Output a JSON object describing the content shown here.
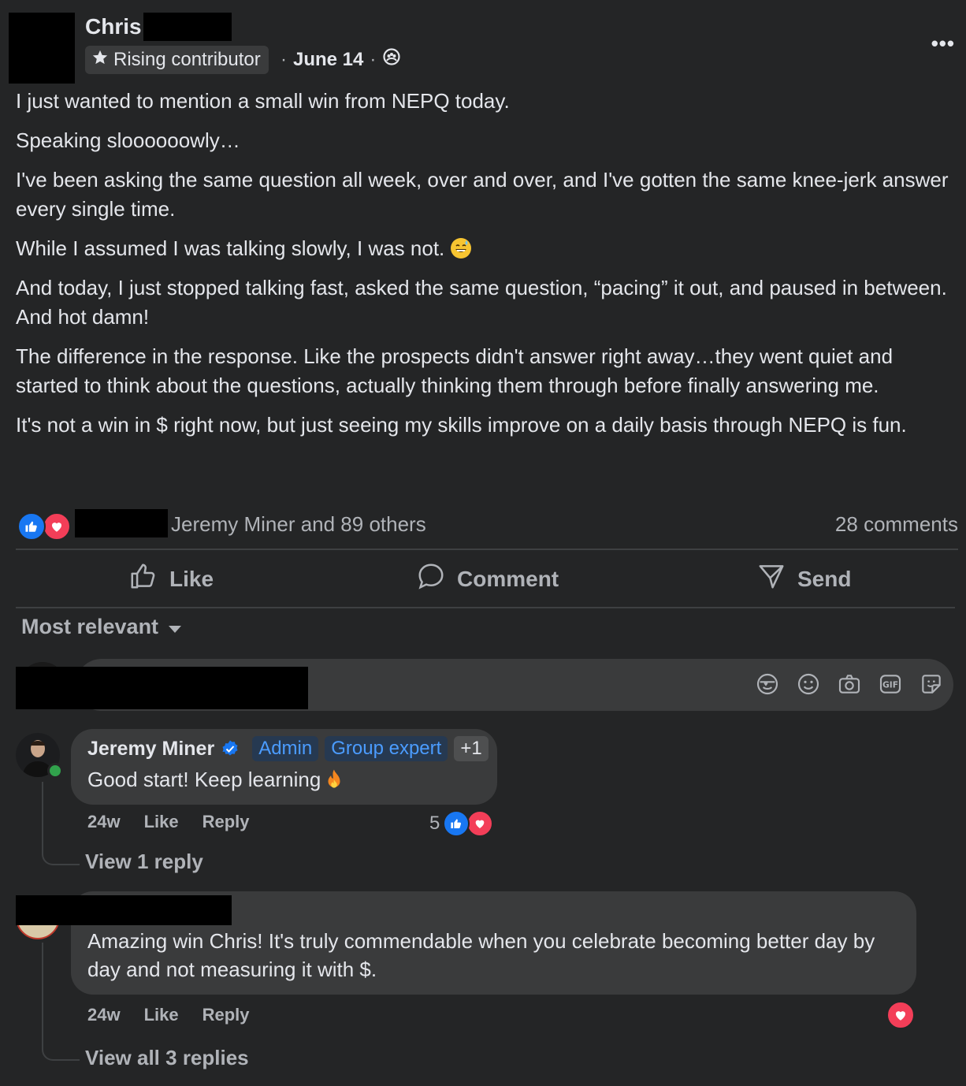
{
  "post": {
    "author_name": "Chris",
    "badge_label": "Rising contributor",
    "meta_separator": "·",
    "date": "June 14",
    "more_label": "•••",
    "paragraphs": [
      "I just wanted to mention a small win from NEPQ today.",
      "Speaking sloooooowly…",
      "I've been asking the same question all week, over and over, and I've gotten the same knee-jerk answer every single time.",
      "While I assumed I was talking slowly, I was not.",
      "And today, I just stopped talking fast, asked the same question, “pacing” it out, and paused in between. And hot damn!",
      "The difference in the response. Like the prospects didn't answer right away…they went quiet and started to think about the questions, actually thinking them through before finally answering me.",
      "It's not a win in $ right now, but just seeing my skills improve on a daily basis through NEPQ is fun."
    ],
    "reactors_text": "Jeremy Miner and 89 others",
    "comments_count": "28 comments"
  },
  "actions": {
    "like": "Like",
    "comment": "Comment",
    "send": "Send"
  },
  "sort": {
    "label": "Most relevant"
  },
  "comments": [
    {
      "name": "Jeremy Miner",
      "tags": [
        "Admin",
        "Group expert",
        "+1"
      ],
      "text": "Good start! Keep learning",
      "time": "24w",
      "like": "Like",
      "reply": "Reply",
      "reaction_count": "5",
      "view_replies": "View 1 reply"
    },
    {
      "name": "",
      "text": "Amazing win Chris! It's truly commendable when you celebrate becoming better day by day and not measuring it with $.",
      "time": "24w",
      "like": "Like",
      "reply": "Reply",
      "view_replies": "View all 3 replies"
    }
  ],
  "colors": {
    "background": "#242526",
    "bubble": "#3a3b3c",
    "like_blue": "#1877f2",
    "love_red": "#f33e58",
    "tag_blue": "#4b9cff"
  }
}
